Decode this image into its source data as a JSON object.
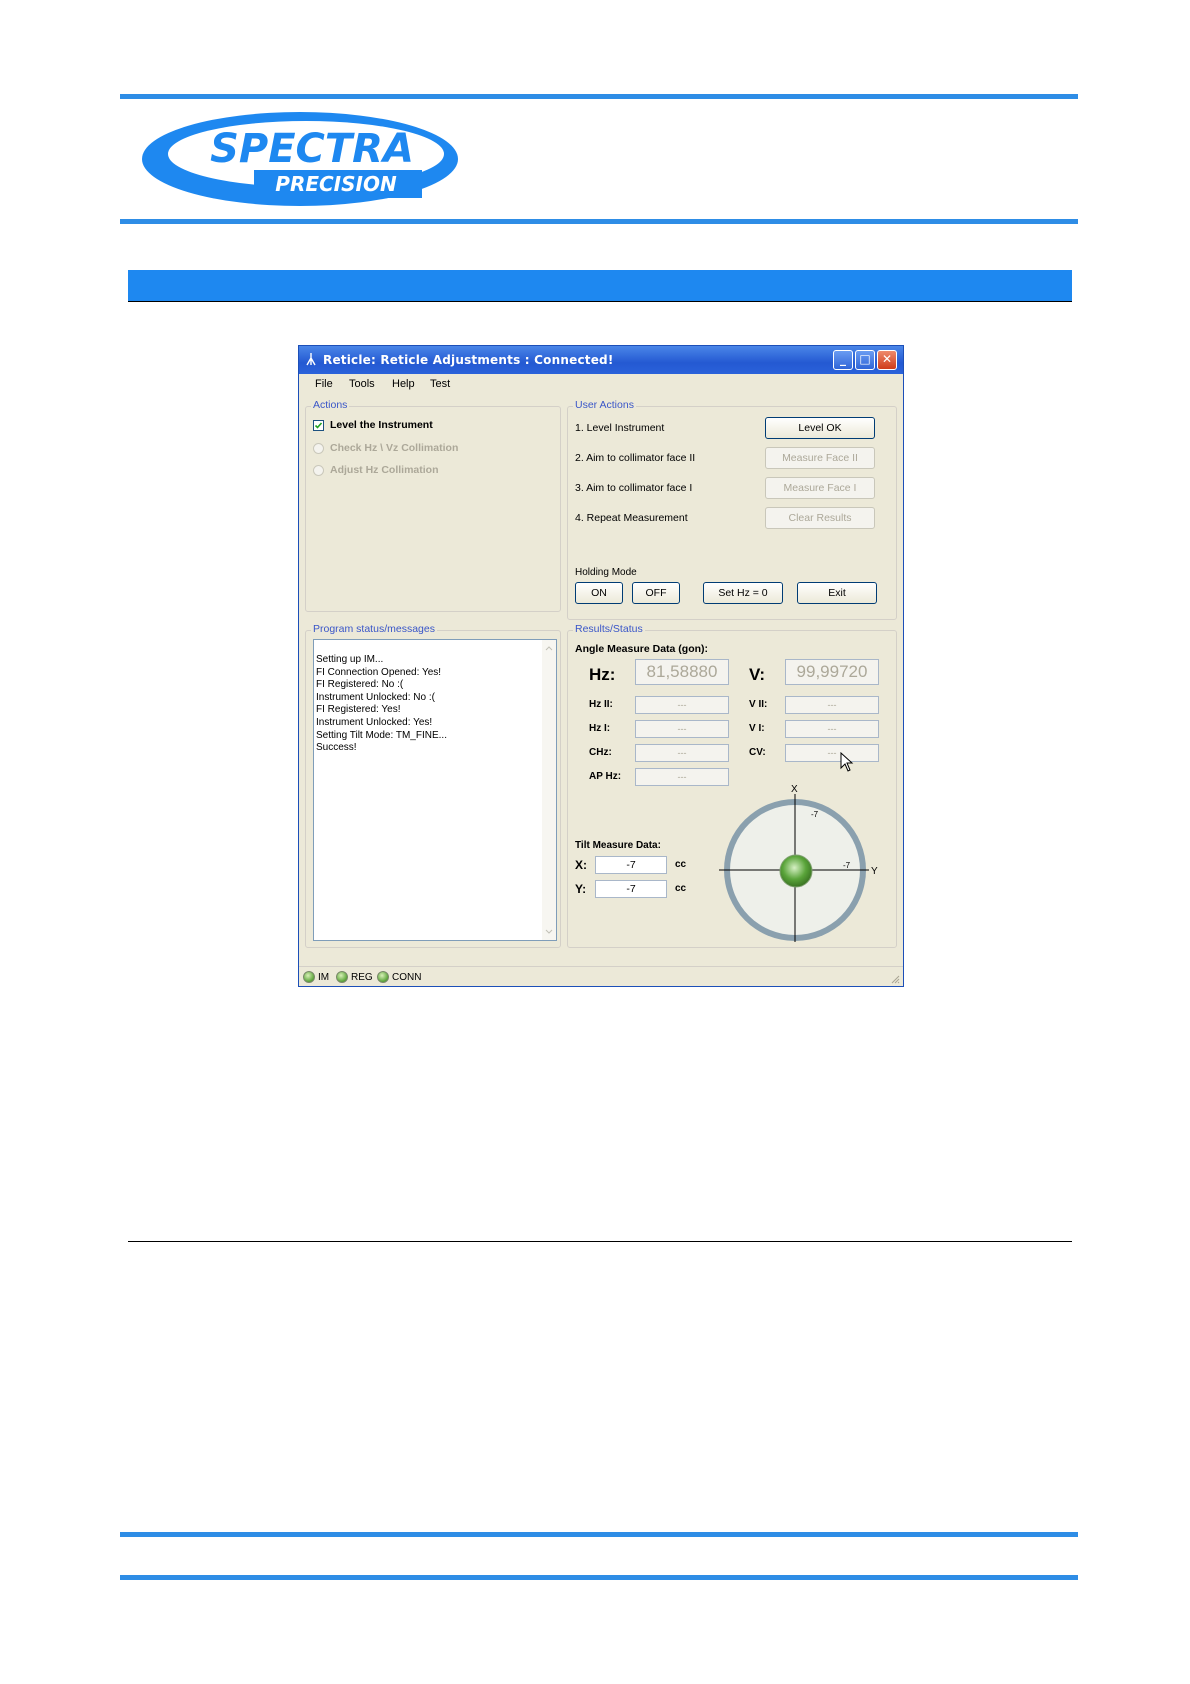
{
  "logo": {
    "top": "SPECTRA",
    "bottom": "PRECISION"
  },
  "window": {
    "title": "Reticle: Reticle Adjustments : Connected!",
    "menu": [
      "File",
      "Tools",
      "Help",
      "Test"
    ],
    "actions": {
      "label": "Actions",
      "items": [
        {
          "label": "Level the Instrument",
          "state": "checked"
        },
        {
          "label": "Check Hz \\ Vz Collimation",
          "state": "disabled"
        },
        {
          "label": "Adjust Hz Collimation",
          "state": "disabled"
        }
      ]
    },
    "user_actions": {
      "label": "User Actions",
      "steps": [
        "1.  Level Instrument",
        "2.  Aim to collimator face II",
        "3.  Aim to collimator face I",
        "4.  Repeat Measurement"
      ],
      "buttons": [
        "Level OK",
        "Measure Face II",
        "Measure Face I",
        "Clear Results"
      ],
      "holding_mode_label": "Holding Mode",
      "on_label": "ON",
      "off_label": "OFF",
      "set_hz_label": "Set Hz = 0",
      "exit_label": "Exit"
    },
    "program_status": {
      "label": "Program status/messages",
      "lines": [
        "Setting up IM...",
        "FI Connection Opened: Yes!",
        "FI Registered: No :(",
        "Instrument Unlocked: No :(",
        "FI Registered: Yes!",
        "Instrument Unlocked: Yes!",
        "Setting Tilt Mode: TM_FINE...",
        "Success!"
      ]
    },
    "results": {
      "label": "Results/Status",
      "angle_title": "Angle Measure Data (gon):",
      "hz_label": "Hz:",
      "hz_value": "81,58880",
      "v_label": "V:",
      "v_value": "99,99720",
      "hz2_label": "Hz II:",
      "hz1_label": "Hz I:",
      "chz_label": "CHz:",
      "aphz_label": "AP Hz:",
      "v2_label": "V II:",
      "v1_label": "V I:",
      "cv_label": "CV:",
      "empty_value": "---",
      "tilt_title": "Tilt Measure Data:",
      "x_label": "X:",
      "x_value": "-7",
      "y_label": "Y:",
      "y_value": "-7",
      "unit": "cc",
      "bubble_x_axis": "X",
      "bubble_y_axis": "Y",
      "bubble_x_value": "-7",
      "bubble_y_value": "-7"
    },
    "status_bar": [
      "IM",
      "REG",
      "CONN"
    ]
  }
}
